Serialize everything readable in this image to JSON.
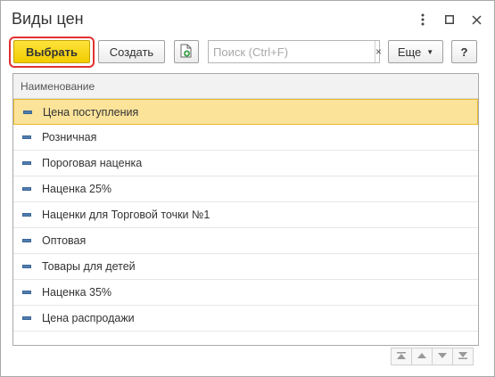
{
  "window": {
    "title": "Виды цен"
  },
  "toolbar": {
    "select_label": "Выбрать",
    "create_label": "Создать",
    "search_placeholder": "Поиск (Ctrl+F)",
    "search_value": "",
    "search_clear": "×",
    "more_label": "Еще",
    "help_label": "?"
  },
  "table": {
    "column_header": "Наименование",
    "rows": [
      "Цена поступления",
      "Розничная",
      "Пороговая наценка",
      "Наценка 25%",
      "Наценки для Торговой точки №1",
      "Оптовая",
      "Товары для детей",
      "Наценка 35%",
      "Цена распродажи"
    ],
    "selected_index": 0
  },
  "colors": {
    "select_button": "#f2cc00",
    "select_outline": "#e0312f",
    "selected_row": "#fbe39a",
    "row_icon": "#4f7fb0"
  }
}
